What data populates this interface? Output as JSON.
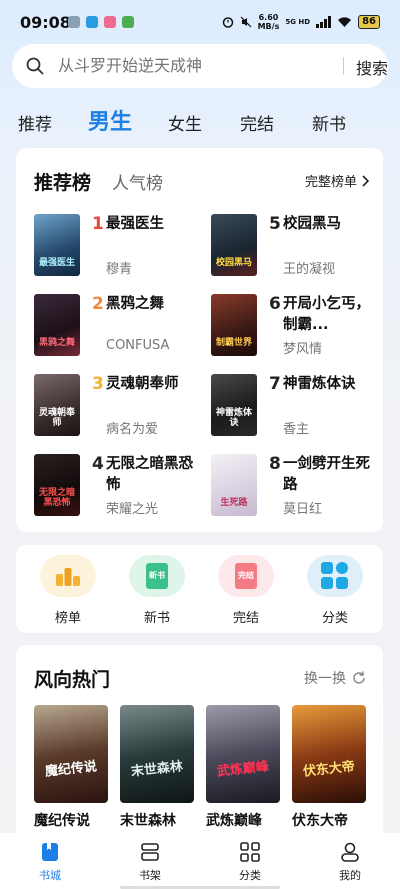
{
  "status_bar": {
    "time": "09:08",
    "speed_value": "6.60",
    "speed_unit": "MB/s",
    "network": "5G HD",
    "battery": "86"
  },
  "search": {
    "placeholder": "从斗罗开始逆天成神",
    "button_label": "搜索"
  },
  "tabs": [
    {
      "label": "推荐",
      "active": false
    },
    {
      "label": "男生",
      "active": true
    },
    {
      "label": "女生",
      "active": false
    },
    {
      "label": "完结",
      "active": false
    },
    {
      "label": "新书",
      "active": false
    }
  ],
  "ranking": {
    "title": "推荐榜",
    "alt_title": "人气榜",
    "full_link": "完整榜单",
    "items": [
      {
        "rank": "1",
        "title": "最强医生",
        "author": "穆青",
        "cover_text": "最强医生"
      },
      {
        "rank": "2",
        "title": "黑鸦之舞",
        "author": "CONFUSA",
        "cover_text": "黑鸦之舞"
      },
      {
        "rank": "3",
        "title": "灵魂朝奉师",
        "author": "病名为爱",
        "cover_text": "灵魂朝奉师"
      },
      {
        "rank": "4",
        "title": "无限之暗黑恐怖",
        "author": "荣耀之光",
        "cover_text": "无限之暗黑恐怖"
      },
      {
        "rank": "5",
        "title": "校园黑马",
        "author": "王的凝视",
        "cover_text": "校园黑马"
      },
      {
        "rank": "6",
        "title": "开局小乞丐，制霸...",
        "author": "梦风情",
        "cover_text": "制霸世界"
      },
      {
        "rank": "7",
        "title": "神雷炼体诀",
        "author": "香主",
        "cover_text": "神雷炼体诀"
      },
      {
        "rank": "8",
        "title": "一剑劈开生死路",
        "author": "莫日红",
        "cover_text": "生死路"
      }
    ]
  },
  "quick_menu": [
    {
      "label": "榜单",
      "icon": "ranking-icon",
      "badge": ""
    },
    {
      "label": "新书",
      "icon": "new-book-icon",
      "badge": "新书"
    },
    {
      "label": "完结",
      "icon": "completed-icon",
      "badge": "完结"
    },
    {
      "label": "分类",
      "icon": "category-icon",
      "badge": ""
    }
  ],
  "trending": {
    "title": "风向热门",
    "refresh_label": "换一换",
    "books": [
      {
        "title": "魔纪传说",
        "cover_text": "魔纪传说"
      },
      {
        "title": "末世森林",
        "cover_text": "末世森林"
      },
      {
        "title": "武炼巅峰",
        "cover_text": "武炼巅峰"
      },
      {
        "title": "伏东大帝",
        "cover_text": "伏东大帝"
      }
    ]
  },
  "bottom_nav": [
    {
      "label": "书城",
      "icon": "bookstore-icon",
      "active": true
    },
    {
      "label": "书架",
      "icon": "bookshelf-icon",
      "active": false
    },
    {
      "label": "分类",
      "icon": "grid-icon",
      "active": false
    },
    {
      "label": "我的",
      "icon": "profile-icon",
      "active": false
    }
  ],
  "colors": {
    "accent": "#1d7fe6",
    "rank1": "#e8453c",
    "rank2": "#f08a3a",
    "rank3": "#f2b233"
  }
}
